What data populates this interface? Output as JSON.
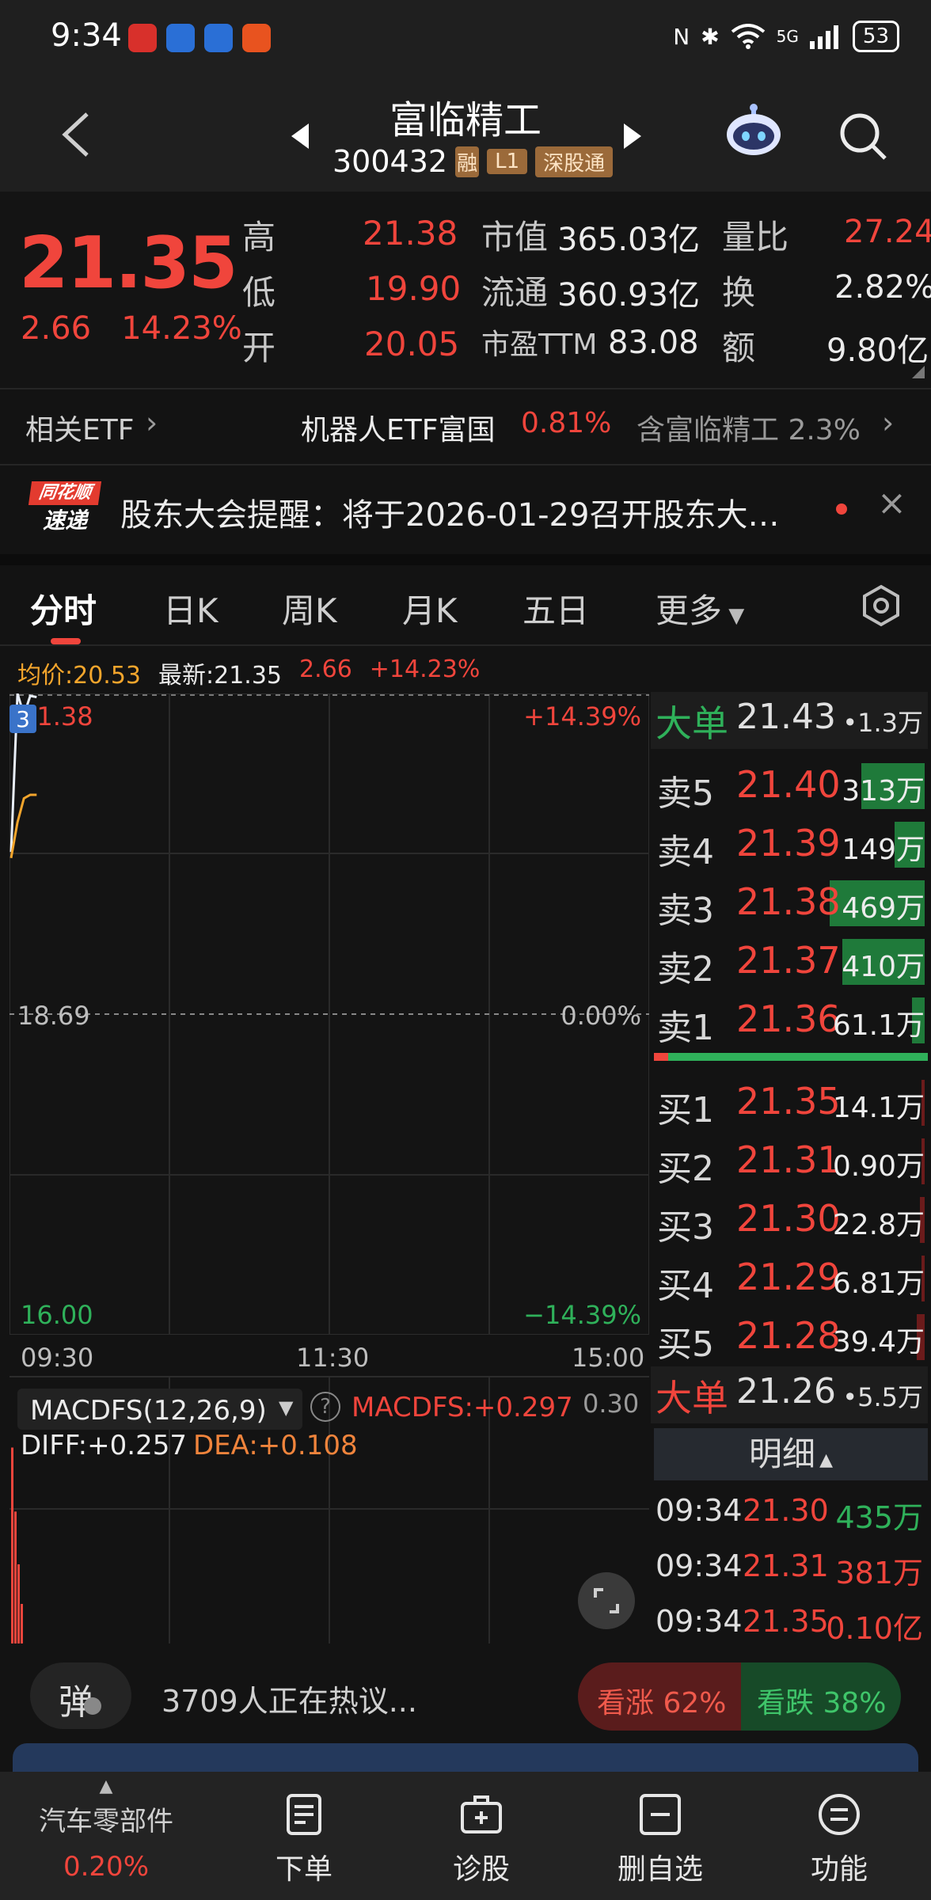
{
  "status_bar": {
    "time": "9:34",
    "battery": "53",
    "network": "5G"
  },
  "header": {
    "title": "富临精工",
    "code": "300432",
    "badge_partial": "融",
    "badge_level": "L1",
    "badge_connect": "深股通"
  },
  "quote": {
    "price": "21.35",
    "change": "2.66",
    "change_pct": "14.23%",
    "high_label": "高",
    "high": "21.38",
    "low_label": "低",
    "low": "19.90",
    "open_label": "开",
    "open": "20.05",
    "mktcap_label": "市值",
    "mktcap": "365.03亿",
    "float_label": "流通",
    "float": "360.93亿",
    "pe_label": "市盈TTM",
    "pe": "83.08",
    "vr_label": "量比",
    "vr": "27.24",
    "turnover_label": "换",
    "turnover": "2.82%",
    "amount_label": "额",
    "amount": "9.80亿"
  },
  "etf": {
    "label": "相关ETF",
    "name": "机器人ETF富国",
    "pct": "0.81%",
    "contains": "含富临精工 2.3%"
  },
  "notice": {
    "logo_line1": "同花顺",
    "logo_line2": "速递",
    "text": "股东大会提醒：将于2026-01-29召开股东大…"
  },
  "tabs": {
    "t1": "分时",
    "t2": "日K",
    "t3": "周K",
    "t4": "月K",
    "t5": "五日",
    "t6": "更多"
  },
  "infoline": {
    "avg": "均价:20.53",
    "latest": "最新:21.35",
    "chg": "2.66",
    "pct": "+14.23%"
  },
  "chart_data": {
    "type": "line",
    "title": "",
    "x_ticks": [
      "09:30",
      "11:30",
      "15:00"
    ],
    "y_ticks_left": [
      "21.38",
      "18.69",
      "16.00"
    ],
    "y_ticks_right": [
      "+14.39%",
      "0.00%",
      "−14.39%"
    ],
    "ylim": [
      16.0,
      21.38
    ],
    "prev_close": 18.69,
    "series": [
      {
        "x": [
          "09:30",
          "09:31",
          "09:32",
          "09:33",
          "09:34"
        ],
        "values": [
          20.05,
          21.38,
          21.2,
          21.36,
          21.35
        ]
      },
      {
        "x": [
          "09:30",
          "09:31",
          "09:32",
          "09:33",
          "09:34"
        ],
        "values": [
          20.0,
          20.3,
          20.5,
          20.53,
          20.53
        ]
      }
    ],
    "marker": "3"
  },
  "macd": {
    "name": "MACDFS(12,26,9)",
    "value": "MACDFS:+0.297",
    "scale": "0.30",
    "diff": "DIFF:+0.257",
    "dea": "DEA:+0.108",
    "bars": [
      0.297,
      0.2,
      0.12,
      0.06
    ]
  },
  "order_book": {
    "big_sell": {
      "label": "大单",
      "price": "21.43",
      "vol": "•1.3万"
    },
    "asks": [
      {
        "side": "卖5",
        "price": "21.40",
        "vol": "313万",
        "level": 0.67
      },
      {
        "side": "卖4",
        "price": "21.39",
        "vol": "149万",
        "level": 0.32
      },
      {
        "side": "卖3",
        "price": "21.38",
        "vol": "469万",
        "level": 1.0
      },
      {
        "side": "卖2",
        "price": "21.37",
        "vol": "410万",
        "level": 0.87
      },
      {
        "side": "卖1",
        "price": "21.36",
        "vol": "61.1万",
        "level": 0.13
      }
    ],
    "bids": [
      {
        "side": "买1",
        "price": "21.35",
        "vol": "14.1万",
        "level": 0.03
      },
      {
        "side": "买2",
        "price": "21.31",
        "vol": "0.90万",
        "level": 0.0
      },
      {
        "side": "买3",
        "price": "21.30",
        "vol": "22.8万",
        "level": 0.05
      },
      {
        "side": "买4",
        "price": "21.29",
        "vol": "6.81万",
        "level": 0.015
      },
      {
        "side": "买5",
        "price": "21.28",
        "vol": "39.4万",
        "level": 0.08
      }
    ],
    "big_buy": {
      "label": "大单",
      "price": "21.26",
      "vol": "•5.5万"
    },
    "detail_label": "明细",
    "trades": [
      {
        "time": "09:34",
        "price": "21.30",
        "vol": "435万",
        "color": "#2fb15a"
      },
      {
        "time": "09:34",
        "price": "21.31",
        "vol": "381万",
        "color": "#f0453c"
      },
      {
        "time": "09:34",
        "price": "21.35",
        "vol": "0.10亿",
        "color": "#f0453c"
      }
    ]
  },
  "social": {
    "danmu_label": "弹",
    "discuss": "3709人正在热议...",
    "bull": "看涨 62%",
    "bear": "看跌 38%",
    "bull_share": 0.62
  },
  "tabbar": {
    "sector": "汽车零部件",
    "sector_pct": "0.20%",
    "order": "下单",
    "diagnose": "诊股",
    "remove": "删自选",
    "function": "功能"
  },
  "colors": {
    "up": "#f0453c",
    "down": "#2fb15a",
    "avg": "#f3a52c",
    "bg": "#131313"
  }
}
